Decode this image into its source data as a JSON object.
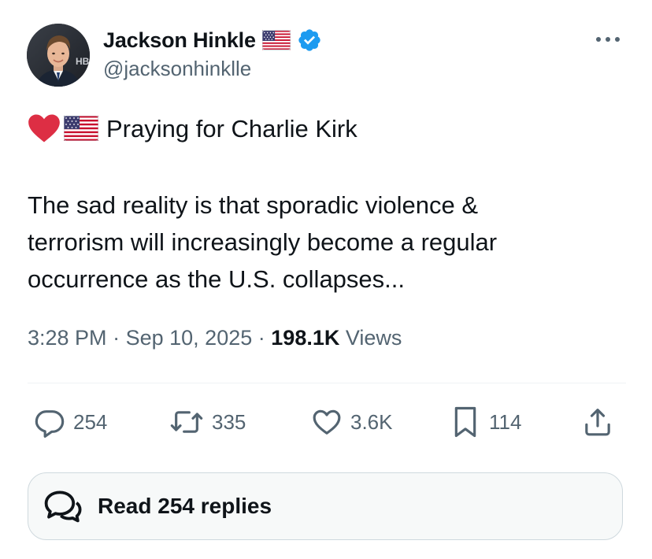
{
  "author": {
    "display_name": "Jackson Hinkle",
    "handle": "@jacksonhinklle",
    "verified": true,
    "avatar_text": "HB",
    "name_emoji": "us-flag-icon"
  },
  "tweet": {
    "emojis": [
      "heart-icon",
      "us-flag-icon"
    ],
    "first_line": "Praying for Charlie Kirk",
    "body_lines": [
      "The sad reality is that sporadic violence &",
      "terrorism will increasingly become a regular",
      "occurrence as the U.S. collapses..."
    ]
  },
  "meta": {
    "time": "3:28 PM",
    "separator": "·",
    "date": "Sep 10, 2025",
    "views_count": "198.1K",
    "views_label": "Views"
  },
  "actions": {
    "replies": "254",
    "reposts": "335",
    "likes": "3.6K",
    "bookmarks": "114"
  },
  "read_replies": {
    "label": "Read 254 replies"
  },
  "colors": {
    "text": "#0f1419",
    "muted": "#536471",
    "verified_blue": "#1d9bf0",
    "heart_red": "#dd2e44",
    "divider": "#eff3f4",
    "button_border": "#cfd9de",
    "button_bg": "#f7f9f9"
  }
}
